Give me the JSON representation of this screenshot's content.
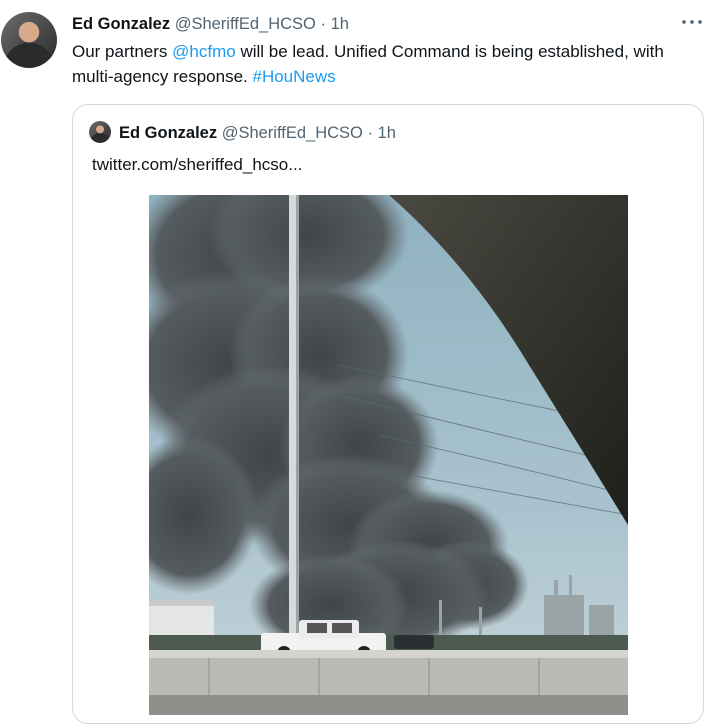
{
  "tweet": {
    "author_name": "Ed Gonzalez",
    "author_handle": "@SheriffEd_HCSO",
    "separator": "·",
    "time": "1h",
    "text_parts": {
      "p1": "Our partners ",
      "mention": "@hcfmo",
      "p2": " will be lead. Unified Command is being established, with multi-agency response. ",
      "hashtag": "#HouNews"
    }
  },
  "quote": {
    "author_name": "Ed Gonzalez",
    "author_handle": "@SheriffEd_HCSO",
    "separator": "·",
    "time": "1h",
    "text": "twitter.com/sheriffed_hcso..."
  },
  "icons": {
    "more": "more-horizontal-icon"
  },
  "colors": {
    "link": "#1d9bf0",
    "secondary_text": "#536471",
    "border": "#cfd9de"
  }
}
